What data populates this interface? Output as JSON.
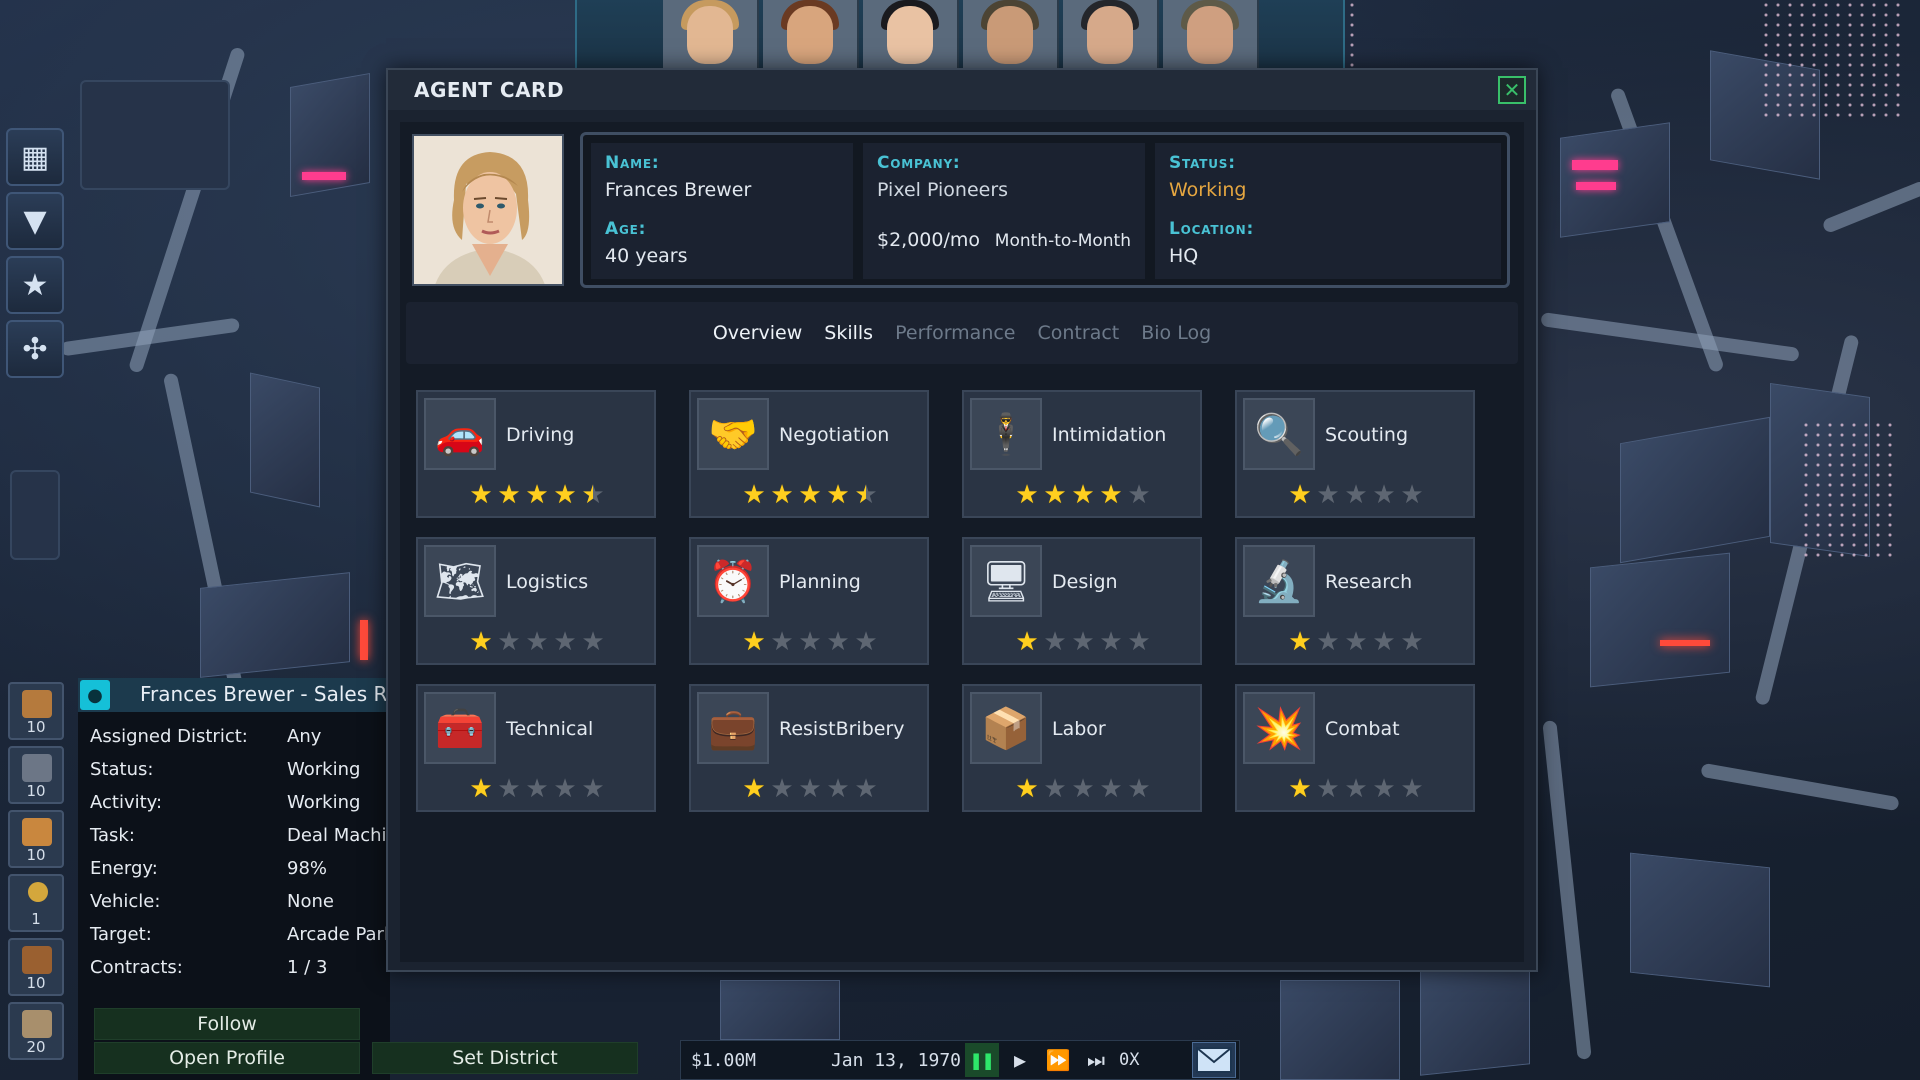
{
  "modal": {
    "title": "AGENT CARD",
    "close_icon": "close-icon"
  },
  "agent": {
    "name_label": "Name:",
    "name": "Frances Brewer",
    "age_label": "Age:",
    "age": "40 years",
    "company_label": "Company:",
    "company": "Pixel Pioneers",
    "salary": "$2,000/mo",
    "contract_type": "Month-to-Month",
    "status_label": "Status:",
    "status": "Working",
    "location_label": "Location:",
    "location": "HQ"
  },
  "tabs": [
    {
      "label": "Overview",
      "active": true
    },
    {
      "label": "Skills",
      "active": true
    },
    {
      "label": "Performance",
      "active": false
    },
    {
      "label": "Contract",
      "active": false
    },
    {
      "label": "Bio Log",
      "active": false
    }
  ],
  "skills": [
    {
      "name": "Driving",
      "icon": "steering-wheel-icon",
      "rating": 4.5
    },
    {
      "name": "Negotiation",
      "icon": "handshake-icon",
      "rating": 4.5
    },
    {
      "name": "Intimidation",
      "icon": "thug-icon",
      "rating": 4
    },
    {
      "name": "Scouting",
      "icon": "magnifier-icon",
      "rating": 1
    },
    {
      "name": "Logistics",
      "icon": "map-icon",
      "rating": 1
    },
    {
      "name": "Planning",
      "icon": "clock-icon",
      "rating": 1
    },
    {
      "name": "Design",
      "icon": "monitor-icon",
      "rating": 1
    },
    {
      "name": "Research",
      "icon": "scientist-icon",
      "rating": 1
    },
    {
      "name": "Technical",
      "icon": "toolbox-icon",
      "rating": 1
    },
    {
      "name": "ResistBribery",
      "icon": "briber-icon",
      "rating": 1
    },
    {
      "name": "Labor",
      "icon": "boxes-icon",
      "rating": 1
    },
    {
      "name": "Combat",
      "icon": "fight-icon",
      "rating": 1
    }
  ],
  "side_panel": {
    "title": "Frances Brewer - Sales R",
    "rows": [
      {
        "key": "Assigned District:",
        "value": "Any"
      },
      {
        "key": "Status:",
        "value": "Working"
      },
      {
        "key": "Activity:",
        "value": "Working"
      },
      {
        "key": "Task:",
        "value": "Deal Machin"
      },
      {
        "key": "Energy:",
        "value": "98%"
      },
      {
        "key": "Vehicle:",
        "value": "None"
      },
      {
        "key": "Target:",
        "value": "Arcade Parl"
      },
      {
        "key": "Contracts:",
        "value": "1 / 3"
      }
    ],
    "follow_label": "Follow",
    "open_profile_label": "Open Profile",
    "set_district_label": "Set District"
  },
  "resources": [
    {
      "icon": "crate-icon",
      "count": "10"
    },
    {
      "icon": "device-icon",
      "count": "10"
    },
    {
      "icon": "package-icon",
      "count": "10"
    },
    {
      "icon": "joystick-icon",
      "count": "1"
    },
    {
      "icon": "cargo-icon",
      "count": "10"
    },
    {
      "icon": "box-icon",
      "count": "20"
    }
  ],
  "left_nav": [
    {
      "icon": "buildings-icon"
    },
    {
      "icon": "tie-icon"
    },
    {
      "icon": "ranking-icon"
    },
    {
      "icon": "network-icon"
    }
  ],
  "time_bar": {
    "money": "$1.00M",
    "date": "Jan 13, 1970",
    "speed": "0X"
  },
  "colors": {
    "label_cyan": "#49c2d4",
    "status_gold": "#e5a640",
    "star_gold": "#ffcf1f",
    "close_green": "#39c06a"
  }
}
